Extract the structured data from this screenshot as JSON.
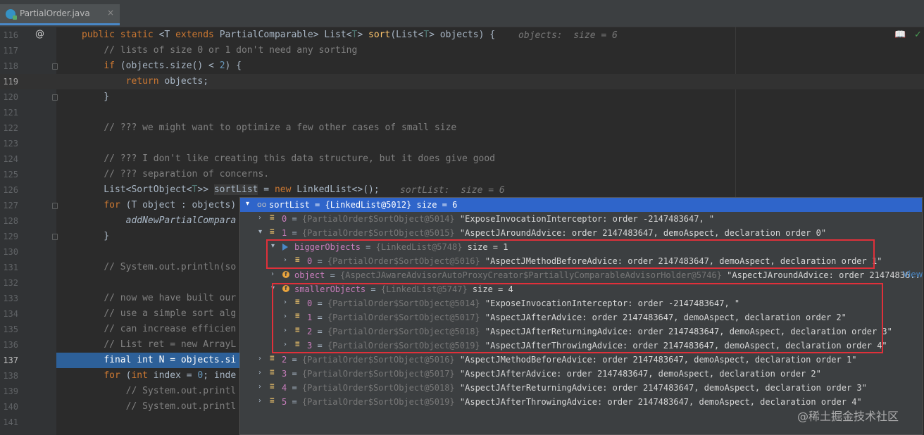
{
  "tab": {
    "filename": "PartialOrder.java",
    "close": "×"
  },
  "gutter_marker": "@",
  "right_icons": {
    "reader": "reader-mode-icon",
    "check": "check-icon"
  },
  "code": [
    {
      "n": "116",
      "t": "public static <T extends PartialComparable> List<T> sort(List<T> objects) {",
      "hint": "objects:  size = 6"
    },
    {
      "n": "117",
      "t": "    // lists of size 0 or 1 don't need any sorting",
      "hint": ""
    },
    {
      "n": "118",
      "t": "    if (objects.size() < 2) {",
      "hint": ""
    },
    {
      "n": "119",
      "t": "        return objects;",
      "hint": ""
    },
    {
      "n": "120",
      "t": "    }",
      "hint": ""
    },
    {
      "n": "121",
      "t": "",
      "hint": ""
    },
    {
      "n": "122",
      "t": "    // ??? we might want to optimize a few other cases of small size",
      "hint": ""
    },
    {
      "n": "123",
      "t": "",
      "hint": ""
    },
    {
      "n": "124",
      "t": "    // ??? I don't like creating this data structure, but it does give good",
      "hint": ""
    },
    {
      "n": "125",
      "t": "    // ??? separation of concerns.",
      "hint": ""
    },
    {
      "n": "126",
      "t": "    List<SortObject<T>> sortList = new LinkedList<>();",
      "hint": "sortList:  size = 6"
    },
    {
      "n": "127",
      "t": "    for (T object : objects)",
      "hint": ""
    },
    {
      "n": "128",
      "t": "        addNewPartialCompara",
      "hint": ""
    },
    {
      "n": "129",
      "t": "    }",
      "hint": ""
    },
    {
      "n": "130",
      "t": "",
      "hint": ""
    },
    {
      "n": "131",
      "t": "    // System.out.println(so",
      "hint": ""
    },
    {
      "n": "132",
      "t": "",
      "hint": ""
    },
    {
      "n": "133",
      "t": "    // now we have built our",
      "hint": ""
    },
    {
      "n": "134",
      "t": "    // use a simple sort alg",
      "hint": ""
    },
    {
      "n": "135",
      "t": "    // can increase efficien",
      "hint": ""
    },
    {
      "n": "136",
      "t": "    // List ret = new ArrayL",
      "hint": ""
    },
    {
      "n": "137",
      "t": "    final int N = objects.si",
      "hint": ""
    },
    {
      "n": "138",
      "t": "    for (int index = 0; inde",
      "hint": ""
    },
    {
      "n": "139",
      "t": "        // System.out.printl",
      "hint": ""
    },
    {
      "n": "140",
      "t": "        // System.out.printl",
      "hint": ""
    },
    {
      "n": "141",
      "t": "",
      "hint": ""
    }
  ],
  "debug_tree": [
    {
      "indent": 0,
      "arrow": "▾",
      "icon": "oo",
      "name": "sortList",
      "ref": "{LinkedList@5012}",
      "value": "size = 6",
      "selected": true
    },
    {
      "indent": 1,
      "arrow": "›",
      "icon": "eq",
      "name": "0",
      "ref": "{PartialOrder$SortObject@5014}",
      "value": "\"ExposeInvocationInterceptor: order -2147483647, \""
    },
    {
      "indent": 1,
      "arrow": "▾",
      "icon": "eq",
      "name": "1",
      "ref": "{PartialOrder$SortObject@5015}",
      "value": "\"AspectJAroundAdvice: order 2147483647, demoAspect, declaration order 0\""
    },
    {
      "indent": 2,
      "arrow": "▾",
      "icon": "flag",
      "name": "biggerObjects",
      "ref": "{LinkedList@5748}",
      "value": "size = 1"
    },
    {
      "indent": 3,
      "arrow": "›",
      "icon": "eq",
      "name": "0",
      "ref": "{PartialOrder$SortObject@5016}",
      "value": "\"AspectJMethodBeforeAdvice: order 2147483647, demoAspect, declaration order 1\""
    },
    {
      "indent": 2,
      "arrow": "›",
      "icon": "f",
      "name": "object",
      "ref": "{AspectJAwareAdvisorAutoProxyCreator$PartiallyComparableAdvisorHolder@5746}",
      "value": "\"AspectJAroundAdvice: order 21474836..."
    },
    {
      "indent": 2,
      "arrow": "▾",
      "icon": "f",
      "name": "smallerObjects",
      "ref": "{LinkedList@5747}",
      "value": "size = 4"
    },
    {
      "indent": 3,
      "arrow": "›",
      "icon": "eq",
      "name": "0",
      "ref": "{PartialOrder$SortObject@5014}",
      "value": "\"ExposeInvocationInterceptor: order -2147483647, \""
    },
    {
      "indent": 3,
      "arrow": "›",
      "icon": "eq",
      "name": "1",
      "ref": "{PartialOrder$SortObject@5017}",
      "value": "\"AspectJAfterAdvice: order 2147483647, demoAspect, declaration order 2\""
    },
    {
      "indent": 3,
      "arrow": "›",
      "icon": "eq",
      "name": "2",
      "ref": "{PartialOrder$SortObject@5018}",
      "value": "\"AspectJAfterReturningAdvice: order 2147483647, demoAspect, declaration order 3\""
    },
    {
      "indent": 3,
      "arrow": "›",
      "icon": "eq",
      "name": "3",
      "ref": "{PartialOrder$SortObject@5019}",
      "value": "\"AspectJAfterThrowingAdvice: order 2147483647, demoAspect, declaration order 4\""
    },
    {
      "indent": 1,
      "arrow": "›",
      "icon": "eq",
      "name": "2",
      "ref": "{PartialOrder$SortObject@5016}",
      "value": "\"AspectJMethodBeforeAdvice: order 2147483647, demoAspect, declaration order 1\""
    },
    {
      "indent": 1,
      "arrow": "›",
      "icon": "eq",
      "name": "3",
      "ref": "{PartialOrder$SortObject@5017}",
      "value": "\"AspectJAfterAdvice: order 2147483647, demoAspect, declaration order 2\""
    },
    {
      "indent": 1,
      "arrow": "›",
      "icon": "eq",
      "name": "4",
      "ref": "{PartialOrder$SortObject@5018}",
      "value": "\"AspectJAfterReturningAdvice: order 2147483647, demoAspect, declaration order 3\""
    },
    {
      "indent": 1,
      "arrow": "›",
      "icon": "eq",
      "name": "5",
      "ref": "{PartialOrder$SortObject@5019}",
      "value": "\"AspectJAfterThrowingAdvice: order 2147483647, demoAspect, declaration order 4\""
    }
  ],
  "view_link": "View",
  "watermark": "@稀土掘金技术社区",
  "colors": {
    "editor_bg": "#2b2b2b",
    "keyword": "#cc7832",
    "exec_line": "#2d6099",
    "popup_bg": "#3c3f41",
    "selected": "#2f65ca",
    "highlight_box": "#e0303a"
  }
}
